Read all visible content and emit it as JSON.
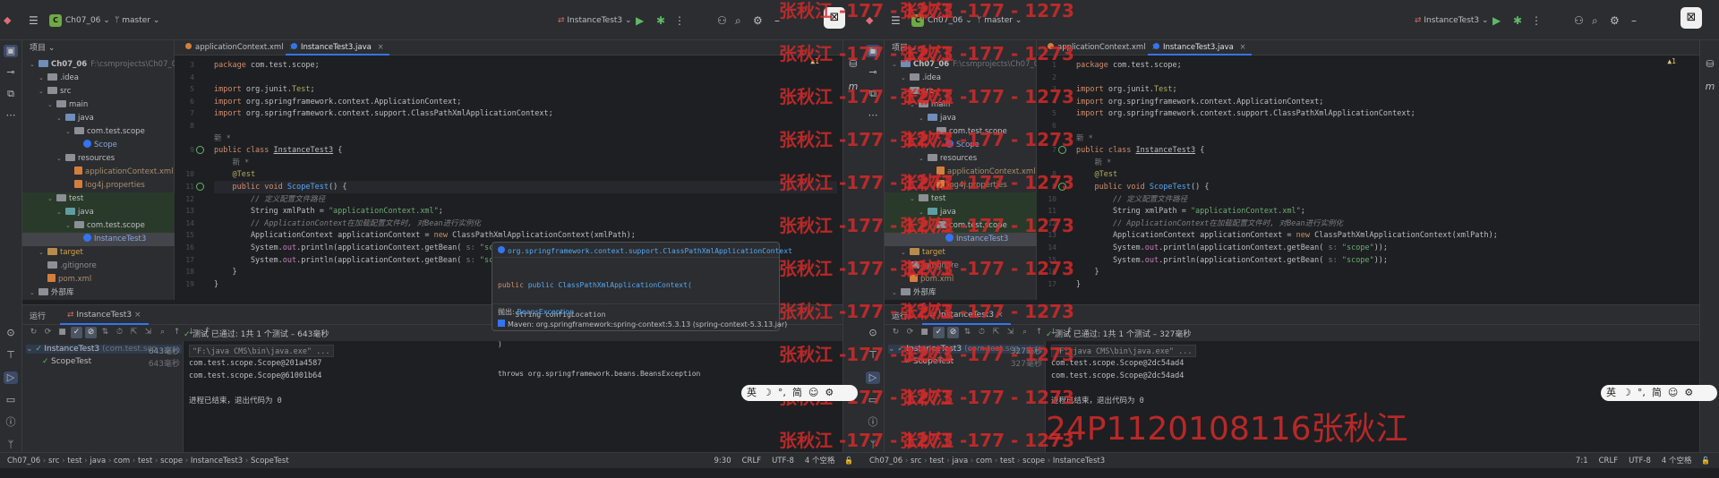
{
  "panes": [
    {
      "project": {
        "badge": "C",
        "name": "Ch07_06",
        "branch": "master",
        "run_config": "InstanceTest3"
      },
      "sidebar_title": "项目",
      "tree": [
        {
          "label": "Ch07_06",
          "extra": "F:\\csmprojects\\Ch07_06",
          "depth": 0,
          "kind": "module",
          "bold": true
        },
        {
          "label": ".idea",
          "depth": 1,
          "kind": "folder-gray"
        },
        {
          "label": "src",
          "depth": 1,
          "kind": "folder-gray"
        },
        {
          "label": "main",
          "depth": 2,
          "kind": "folder-gray"
        },
        {
          "label": "java",
          "depth": 3,
          "kind": "folder"
        },
        {
          "label": "com.test.scope",
          "depth": 4,
          "kind": "folder-gray"
        },
        {
          "label": "Scope",
          "depth": 5,
          "kind": "class"
        },
        {
          "label": "resources",
          "depth": 3,
          "kind": "folder-gray"
        },
        {
          "label": "applicationContext.xml",
          "depth": 4,
          "kind": "xml"
        },
        {
          "label": "log4j.properties",
          "depth": 4,
          "kind": "props"
        },
        {
          "label": "test",
          "depth": 2,
          "kind": "folder-gray"
        },
        {
          "label": "java",
          "depth": 3,
          "kind": "folder-teal"
        },
        {
          "label": "com.test.scope",
          "depth": 4,
          "kind": "folder-gray"
        },
        {
          "label": "InstanceTest3",
          "depth": 5,
          "kind": "class",
          "selected": true
        },
        {
          "label": "target",
          "depth": 1,
          "kind": "folder-orange"
        },
        {
          "label": ".gitignore",
          "depth": 1,
          "kind": "file"
        },
        {
          "label": "pom.xml",
          "depth": 1,
          "kind": "xml"
        },
        {
          "label": "外部库",
          "depth": 0,
          "kind": "lib"
        }
      ],
      "tabs": [
        {
          "label": "applicationContext.xml",
          "active": false
        },
        {
          "label": "InstanceTest3.java",
          "active": true
        }
      ],
      "code": [
        {
          "n": "3",
          "html": "<span class='kw'>package</span> com.test.scope;"
        },
        {
          "n": "4",
          "html": ""
        },
        {
          "n": "5",
          "html": "<span class='kw'>import</span> org.junit.<span class='ann'>Test</span>;"
        },
        {
          "n": "6",
          "html": "<span class='kw'>import</span> org.springframework.context.ApplicationContext;"
        },
        {
          "n": "7",
          "html": "<span class='kw'>import</span> org.springframework.context.support.ClassPathXmlApplicationContext;"
        },
        {
          "n": "8",
          "html": ""
        },
        {
          "n": "",
          "html": "<span class='hint'>新 *</span>"
        },
        {
          "n": "9",
          "html": "<span class='kw'>public class</span> <span class='cn' style='text-decoration:underline'>InstanceTest3</span> {"
        },
        {
          "n": "",
          "html": "    <span class='hint'>新 *</span>"
        },
        {
          "n": "10",
          "html": "    <span class='ann'>@Test</span>"
        },
        {
          "n": "11",
          "html": "    <span class='kw'>public void</span> <span class='fn'>ScopeTest</span>() {"
        },
        {
          "n": "12",
          "html": "        <span class='cmt'>// 定义配置文件路径</span>"
        },
        {
          "n": "13",
          "html": "        String xmlPath = <span class='str'>\"applicationContext.xml\"</span>;"
        },
        {
          "n": "14",
          "html": "        <span class='cmt'>// ApplicationContext在加载配置文件时, 对Bean进行实例化</span>"
        },
        {
          "n": "15",
          "html": "        ApplicationContext applicationContext = <span class='kw'>new</span> ClassPathXmlApplicationContext(xmlPath);"
        },
        {
          "n": "16",
          "html": "        System.<span class='fld'>out</span>.println(applicationContext.getBean( <span class='hint'>s:</span> <span class='str'>\"scope\"</span>));"
        },
        {
          "n": "17",
          "html": "        System.<span class='fld'>out</span>.println(applicationContext.getBean( <span class='hint'>s:</span> <span class='str'>\"scope\"</span>));"
        },
        {
          "n": "18",
          "html": "    }"
        },
        {
          "n": "19",
          "html": "}"
        }
      ],
      "run": {
        "title": "运行",
        "tab": "InstanceTest3",
        "summary": "测试 已通过: 1共 1 个测试 – 643毫秒",
        "root": "InstanceTest3",
        "root_extra": "(com.test.sco",
        "root_time": "643毫秒",
        "child": "ScopeTest",
        "child_time": "643毫秒"
      },
      "console": [
        "\"F:\\java CMS\\bin\\java.exe\" ...",
        "com.test.scope.Scope@201a4587",
        "com.test.scope.Scope@61001b64",
        "",
        "进程已结束，退出代码为 0"
      ],
      "status": {
        "crumbs": [
          "Ch07_06",
          "src",
          "test",
          "java",
          "com",
          "test",
          "scope",
          "InstanceTest3",
          "ScopeTest"
        ],
        "pos": "9:30",
        "eol": "CRLF",
        "enc": "UTF-8",
        "indent": "4 个空格"
      },
      "warn": "▲1"
    },
    {
      "project": {
        "badge": "C",
        "name": "Ch07_06",
        "branch": "master",
        "run_config": "InstanceTest3"
      },
      "sidebar_title": "项目",
      "tree": [
        {
          "label": "Ch07_06",
          "extra": "F:\\csmprojects\\Ch07_06",
          "depth": 0,
          "kind": "module",
          "bold": true
        },
        {
          "label": ".idea",
          "depth": 1,
          "kind": "folder-gray"
        },
        {
          "label": "src",
          "depth": 1,
          "kind": "folder-gray"
        },
        {
          "label": "main",
          "depth": 2,
          "kind": "folder-gray"
        },
        {
          "label": "java",
          "depth": 3,
          "kind": "folder"
        },
        {
          "label": "com.test.scope",
          "depth": 4,
          "kind": "folder-gray"
        },
        {
          "label": "Scope",
          "depth": 5,
          "kind": "class"
        },
        {
          "label": "resources",
          "depth": 3,
          "kind": "folder-gray"
        },
        {
          "label": "applicationContext.xml",
          "depth": 4,
          "kind": "xml"
        },
        {
          "label": "log4j.properties",
          "depth": 4,
          "kind": "props"
        },
        {
          "label": "test",
          "depth": 2,
          "kind": "folder-gray"
        },
        {
          "label": "java",
          "depth": 3,
          "kind": "folder-teal"
        },
        {
          "label": "com.test.scope",
          "depth": 4,
          "kind": "folder-gray"
        },
        {
          "label": "InstanceTest3",
          "depth": 5,
          "kind": "class",
          "selected": true
        },
        {
          "label": "target",
          "depth": 1,
          "kind": "folder-orange"
        },
        {
          "label": ".gitignore",
          "depth": 1,
          "kind": "file"
        },
        {
          "label": "pom.xml",
          "depth": 1,
          "kind": "xml"
        },
        {
          "label": "外部库",
          "depth": 0,
          "kind": "lib"
        }
      ],
      "tabs": [
        {
          "label": "applicationContext.xml",
          "active": false
        },
        {
          "label": "InstanceTest3.java",
          "active": true
        }
      ],
      "code": [
        {
          "n": "1",
          "html": "<span class='kw'>package</span> com.test.scope;"
        },
        {
          "n": "2",
          "html": ""
        },
        {
          "n": "3",
          "html": "<span class='kw'>import</span> org.junit.<span class='ann'>Test</span>;"
        },
        {
          "n": "4",
          "html": "<span class='kw'>import</span> org.springframework.context.ApplicationContext;"
        },
        {
          "n": "5",
          "html": "<span class='kw'>import</span> org.springframework.context.support.ClassPathXmlApplicationContext;"
        },
        {
          "n": "6",
          "html": ""
        },
        {
          "n": "",
          "html": "<span class='hint'>新 *</span>"
        },
        {
          "n": "7",
          "html": "<span class='kw'>public class</span> <span class='cn' style='text-decoration:underline'>InstanceTest3</span> {"
        },
        {
          "n": "",
          "html": "    <span class='hint'>新 *</span>"
        },
        {
          "n": "8",
          "html": "    <span class='ann'>@Test</span>"
        },
        {
          "n": "9",
          "html": "    <span class='kw'>public void</span> <span class='fn'>ScopeTest</span>() {"
        },
        {
          "n": "10",
          "html": "        <span class='cmt'>// 定义配置文件路径</span>"
        },
        {
          "n": "11",
          "html": "        String xmlPath = <span class='str'>\"applicationContext.xml\"</span>;"
        },
        {
          "n": "12",
          "html": "        <span class='cmt'>// ApplicationContext在加载配置文件时, 对Bean进行实例化</span>"
        },
        {
          "n": "13",
          "html": "        ApplicationContext applicationContext = <span class='kw'>new</span> ClassPathXmlApplicationContext(xmlPath);"
        },
        {
          "n": "14",
          "html": "        System.<span class='fld'>out</span>.println(applicationContext.getBean( <span class='hint'>s:</span> <span class='str'>\"scope\"</span>));"
        },
        {
          "n": "15",
          "html": "        System.<span class='fld'>out</span>.println(applicationContext.getBean( <span class='hint'>s:</span> <span class='str'>\"scope\"</span>));"
        },
        {
          "n": "16",
          "html": "    }"
        },
        {
          "n": "17",
          "html": "}"
        }
      ],
      "run": {
        "title": "运行",
        "tab": "InstanceTest3",
        "summary": "测试 已通过: 1共 1 个测试 – 327毫秒",
        "root": "InstanceTest3",
        "root_extra": "(com.test.sco",
        "root_time": "327毫秒",
        "child": "ScopeTest",
        "child_time": "327毫秒"
      },
      "console": [
        "\"F:\\java CMS\\bin\\java.exe\" ...",
        "com.test.scope.Scope@2dc54ad4",
        "com.test.scope.Scope@2dc54ad4",
        "",
        "进程已结束，退出代码为 0"
      ],
      "status": {
        "crumbs": [
          "Ch07_06",
          "src",
          "test",
          "java",
          "com",
          "test",
          "scope",
          "InstanceTest3"
        ],
        "pos": "7:1",
        "eol": "CRLF",
        "enc": "UTF-8",
        "indent": "4 个空格"
      },
      "warn": "▲1"
    }
  ],
  "popup": {
    "line1": "org.springframework.context.support.ClassPathXmlApplicationContext",
    "line2": "public ClassPathXmlApplicationContext(",
    "line3": "    String configLocation",
    "line4": ")",
    "line5": "throws org.springframework.beans.BeansException",
    "throws_label": "抛出:",
    "throws_val": "BeansException",
    "maven": "Maven: org.springframework:spring-context:5.3.13 (spring-context-5.3.13.jar)"
  },
  "ime": {
    "items": [
      "英",
      "☽",
      "°,",
      "简",
      "☺",
      "⚙"
    ]
  },
  "watermark": {
    "text": "张秋江 -177 - 1273",
    "big": "24P1120108116张秋江",
    "color": "#d42a2a"
  }
}
